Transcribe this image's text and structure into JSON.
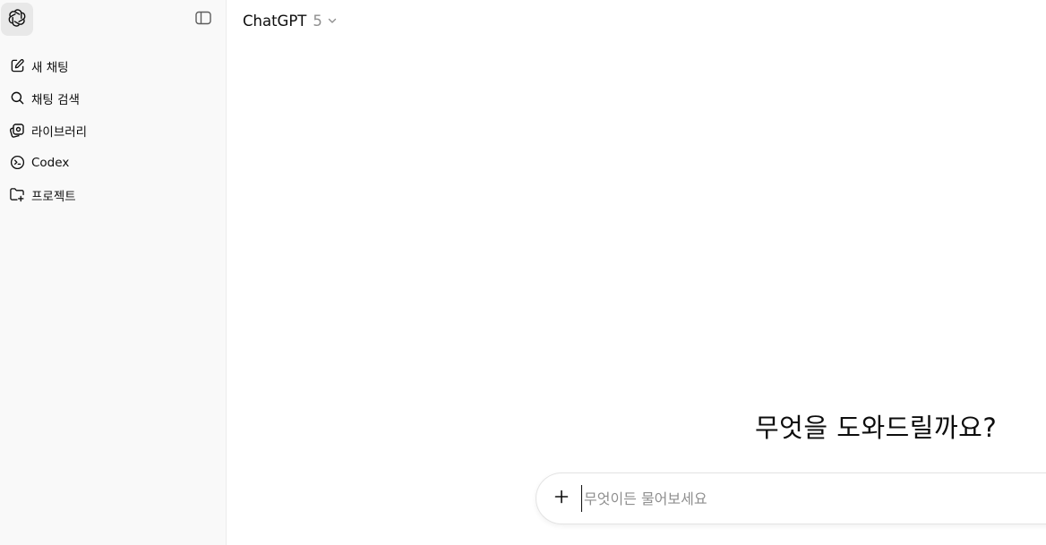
{
  "sidebar": {
    "logo_icon": "openai-logo-icon",
    "toggle_icon": "sidebar-toggle-icon",
    "items": [
      {
        "label": "새 채팅",
        "icon": "edit-icon"
      },
      {
        "label": "채팅 검색",
        "icon": "search-icon"
      },
      {
        "label": "라이브러리",
        "icon": "library-icon"
      },
      {
        "label": "Codex",
        "icon": "codex-icon"
      },
      {
        "label": "프로젝트",
        "icon": "new-folder-icon"
      }
    ]
  },
  "header": {
    "model_name": "ChatGPT",
    "model_version": "5",
    "chevron_icon": "chevron-down-icon"
  },
  "main": {
    "greeting": "무엇을 도와드릴까요?"
  },
  "composer": {
    "plus_icon": "plus-icon",
    "placeholder": "무엇이든 물어보세요",
    "value": ""
  },
  "colors": {
    "sidebar_bg": "#f9f9f9",
    "text": "#0d0d0d",
    "muted": "#8f8f8f"
  }
}
